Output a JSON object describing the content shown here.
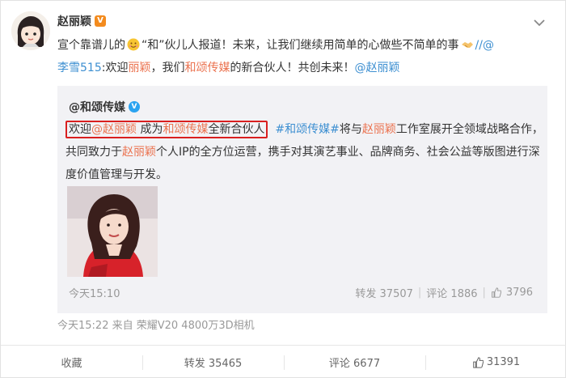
{
  "post": {
    "author": "赵丽颖",
    "author_badge": "V",
    "text_part1": "宣个靠谱儿的",
    "text_part2": "“和”伙儿人报道！未来，让我们继续用简单的心做些不简单的事",
    "text_part3": "//@",
    "text_mention_li": "李雪515",
    "text_part4": ":欢迎",
    "text_link_zhao": "丽颖",
    "text_part5": "，我们",
    "text_link_hesong": "和颂传媒",
    "text_part6": "的新合伙人！共创未来！",
    "text_mention_zhao": "@赵丽颖",
    "meta": "今天15:22 来自 荣耀V20 4800万3D相机"
  },
  "repost": {
    "author": "@和颂传媒",
    "welcome": "欢迎",
    "mention_zhao": "@赵丽颖",
    "become": " 成为",
    "link_hesong": "和颂传媒",
    "new_partner": "全新合伙人",
    "hashtag": "#和颂传媒#",
    "text_a": "将与",
    "link_zhao": "赵丽颖",
    "text_b": "工作室展开全领域战略合作，共同致力于",
    "link_zhao2": "赵丽颖",
    "text_c": "个人IP的全方位运营，携手对其演艺事业、品牌商务、社会公益等版图进行深度价值管理与开发。",
    "time": "今天15:10",
    "forward": "转发 37507",
    "comment": "评论 1886",
    "like": "3796"
  },
  "actions": {
    "favorite": "收藏",
    "forward": "转发 35465",
    "comment": "评论 6677",
    "like": "31391"
  },
  "colors": {
    "link": "#eb7350",
    "mention": "#3d8fd1",
    "highlight_border": "#d91f1f",
    "repost_bg": "#f2f2f5"
  }
}
